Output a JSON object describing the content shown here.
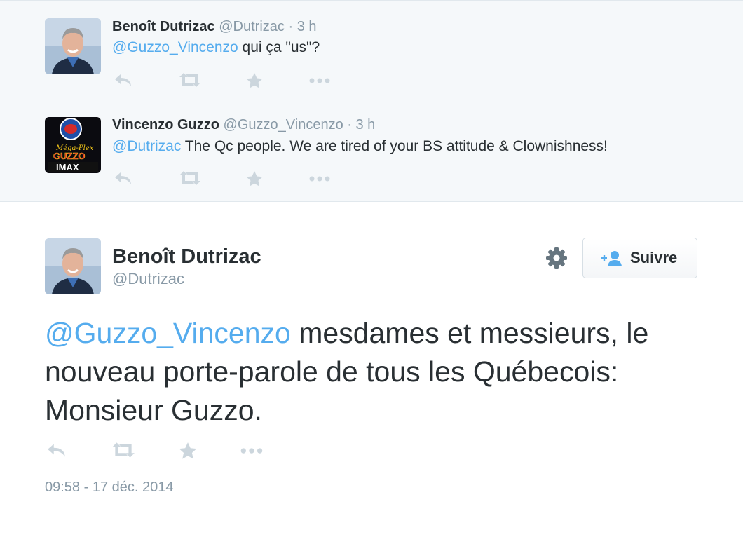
{
  "replies": [
    {
      "name": "Benoît Dutrizac",
      "handle": "@Dutrizac",
      "dot": "·",
      "time": "3 h",
      "mention": "@Guzzo_Vincenzo",
      "text": " qui ça \"us\"?",
      "avatar": "headshot-avatar"
    },
    {
      "name": "Vincenzo Guzzo",
      "handle": "@Guzzo_Vincenzo",
      "dot": "·",
      "time": "3 h",
      "mention": "@Dutrizac",
      "text": " The Qc people. We are tired of your BS attitude & Clownishness!",
      "avatar": "mega-plex-guzzo-imax-logo"
    }
  ],
  "logo": {
    "line1": "Méga-Plex",
    "line2": "GUZZO",
    "line3": "IMAX"
  },
  "main_tweet": {
    "name": "Benoît Dutrizac",
    "handle": "@Dutrizac",
    "follow_label": "Suivre",
    "mention": "@Guzzo_Vincenzo",
    "text": " mesdames et messieurs, le nouveau porte-parole de tous les Québecois: Monsieur Guzzo.",
    "timestamp": "09:58 - 17 déc. 2014"
  },
  "icons": [
    "reply-icon",
    "retweet-icon",
    "favorite-icon",
    "more-icon",
    "gear-icon",
    "follow-icon"
  ],
  "colors": {
    "mention": "#55acee",
    "muted": "#8899a6",
    "text": "#292f33",
    "reply_background": "#f5f8fa",
    "action_icon": "#ccd6dd"
  }
}
